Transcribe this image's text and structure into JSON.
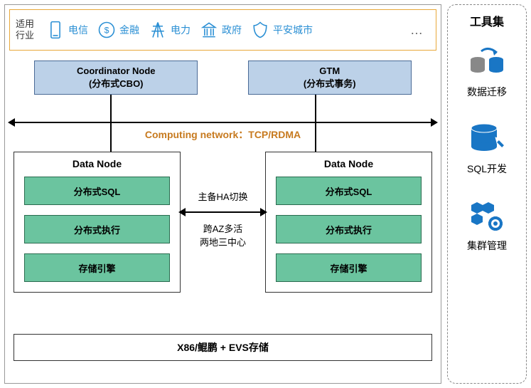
{
  "industry": {
    "label": "适用行业",
    "items": [
      {
        "name": "telecom-icon",
        "label": "电信"
      },
      {
        "name": "finance-icon",
        "label": "金融"
      },
      {
        "name": "power-icon",
        "label": "电力"
      },
      {
        "name": "government-icon",
        "label": "政府"
      },
      {
        "name": "safecity-icon",
        "label": "平安城市"
      }
    ],
    "more": "…"
  },
  "top_nodes": {
    "coordinator": {
      "title": "Coordinator Node",
      "subtitle": "(分布式CBO)"
    },
    "gtm": {
      "title": "GTM",
      "subtitle": "(分布式事务)"
    }
  },
  "network": {
    "label": "Computing network：TCP/RDMA"
  },
  "data_nodes": {
    "left": {
      "title": "Data Node",
      "components": [
        "分布式SQL",
        "分布式执行",
        "存储引擎"
      ]
    },
    "right": {
      "title": "Data Node",
      "components": [
        "分布式SQL",
        "分布式执行",
        "存储引擎"
      ]
    }
  },
  "middle": {
    "line1": "主备HA切换",
    "line2": "跨AZ多活",
    "line3": "两地三中心"
  },
  "storage": {
    "label": "X86/鲲鹏 + EVS存储"
  },
  "toolset": {
    "header": "工具集",
    "tools": [
      {
        "name": "data-migration-icon",
        "label": "数据迁移"
      },
      {
        "name": "sql-dev-icon",
        "label": "SQL开发"
      },
      {
        "name": "cluster-mgmt-icon",
        "label": "集群管理"
      }
    ]
  }
}
